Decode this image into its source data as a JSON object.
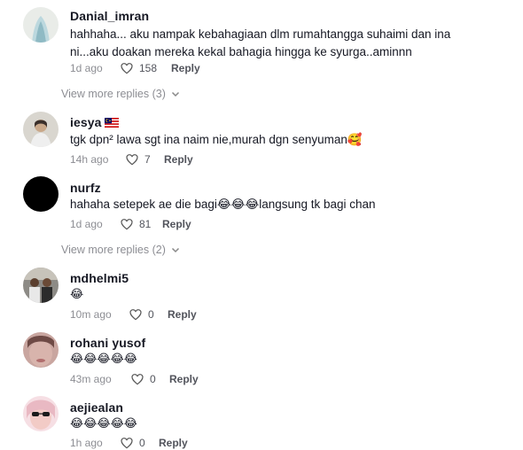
{
  "comments": [
    {
      "username": "Danial_imran",
      "text": "hahhaha... aku nampak kebahagiaan dlm rumahtangga suhaimi dan ina ni...aku doakan mereka kekal bahagia hingga ke syurga..aminnn",
      "age": "1d ago",
      "likes": "158",
      "reply": "Reply",
      "view_more": "View more replies (3)"
    },
    {
      "username": "iesya",
      "text": "tgk dpn² lawa sgt ina naim nie,murah dgn senyuman🥰",
      "age": "14h ago",
      "likes": "7",
      "reply": "Reply"
    },
    {
      "username": "nurfz",
      "text": "hahaha setepek ae die bagi😂😂😂langsung tk bagi chan",
      "age": "1d ago",
      "likes": "81",
      "reply": "Reply",
      "view_more": "View more replies (2)"
    },
    {
      "username": "mdhelmi5",
      "text": "😂",
      "age": "10m ago",
      "likes": "0",
      "reply": "Reply"
    },
    {
      "username": "rohani yusof",
      "text": "😂😂😂😂😂",
      "age": "43m ago",
      "likes": "0",
      "reply": "Reply"
    },
    {
      "username": "aejiealan",
      "text": "😂😂😂😂😂",
      "age": "1h ago",
      "likes": "0",
      "reply": "Reply"
    }
  ],
  "icons": {
    "heart": "heart-outline-icon",
    "chevron": "chevron-down-icon",
    "flag": "malaysia-flag-icon"
  },
  "colors": {
    "text": "#161823",
    "muted": "rgba(22,24,35,0.5)"
  }
}
